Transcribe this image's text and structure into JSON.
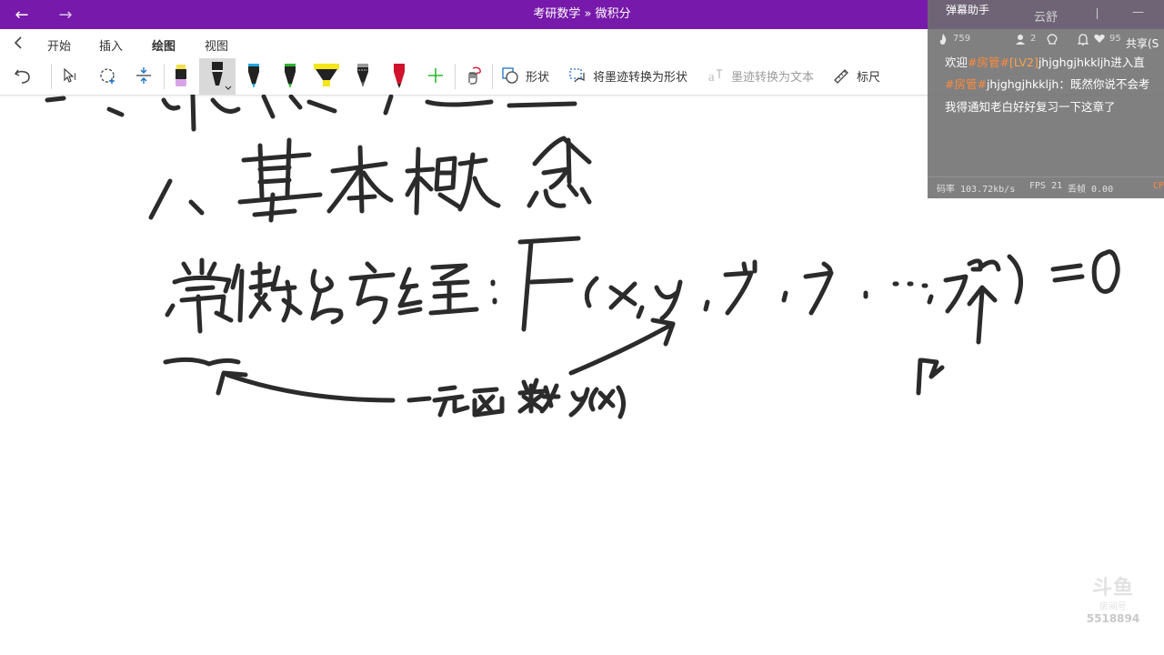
{
  "titlebar": {
    "title": "考研数学 » 微积分",
    "back_icon": "arrow-left-icon",
    "forward_icon": "arrow-right-icon",
    "bg_color": "#7719aa"
  },
  "ribbon": {
    "back_icon": "chevron-left-icon",
    "tabs": [
      {
        "label": "开始"
      },
      {
        "label": "插入"
      },
      {
        "label": "绘图",
        "active": true
      },
      {
        "label": "视图"
      }
    ],
    "tools": {
      "shape_label": "形状",
      "ink_to_shape_label": "将墨迹转换为形状",
      "ink_to_text_label": "墨迹转换为文本",
      "ruler_label": "标尺"
    },
    "pen_colors": [
      "#222222",
      "#1fa8e0",
      "#2fb52f",
      "#f5e51b",
      "#9a9a9a",
      "#d0122d"
    ],
    "add_pen_color": "#2fb52f"
  },
  "danmaku": {
    "title": "弹幕助手",
    "user": "云舒",
    "minimize": "—",
    "share": "共享(S",
    "stats": {
      "popularity": "759",
      "count2": "2",
      "likes": "95"
    },
    "messages": [
      {
        "prefix": "欢迎",
        "room": "#房管#",
        "level": "[LV2]",
        "text": "jhjghgjhkkljh进入直"
      },
      {
        "room": "#房管#",
        "text": "jhjghgjhkkljh：既然你说不会考"
      },
      {
        "text": "我得通知老白好好复习一下这章了"
      }
    ],
    "footer": {
      "bitrate": "码率 103.72kb/s",
      "fps": "FPS 21",
      "drop": "丢帧 0.00",
      "cp": "CP"
    }
  },
  "watermark": {
    "logo": "斗鱼",
    "sub": "房间号",
    "room_id": "5518894"
  }
}
